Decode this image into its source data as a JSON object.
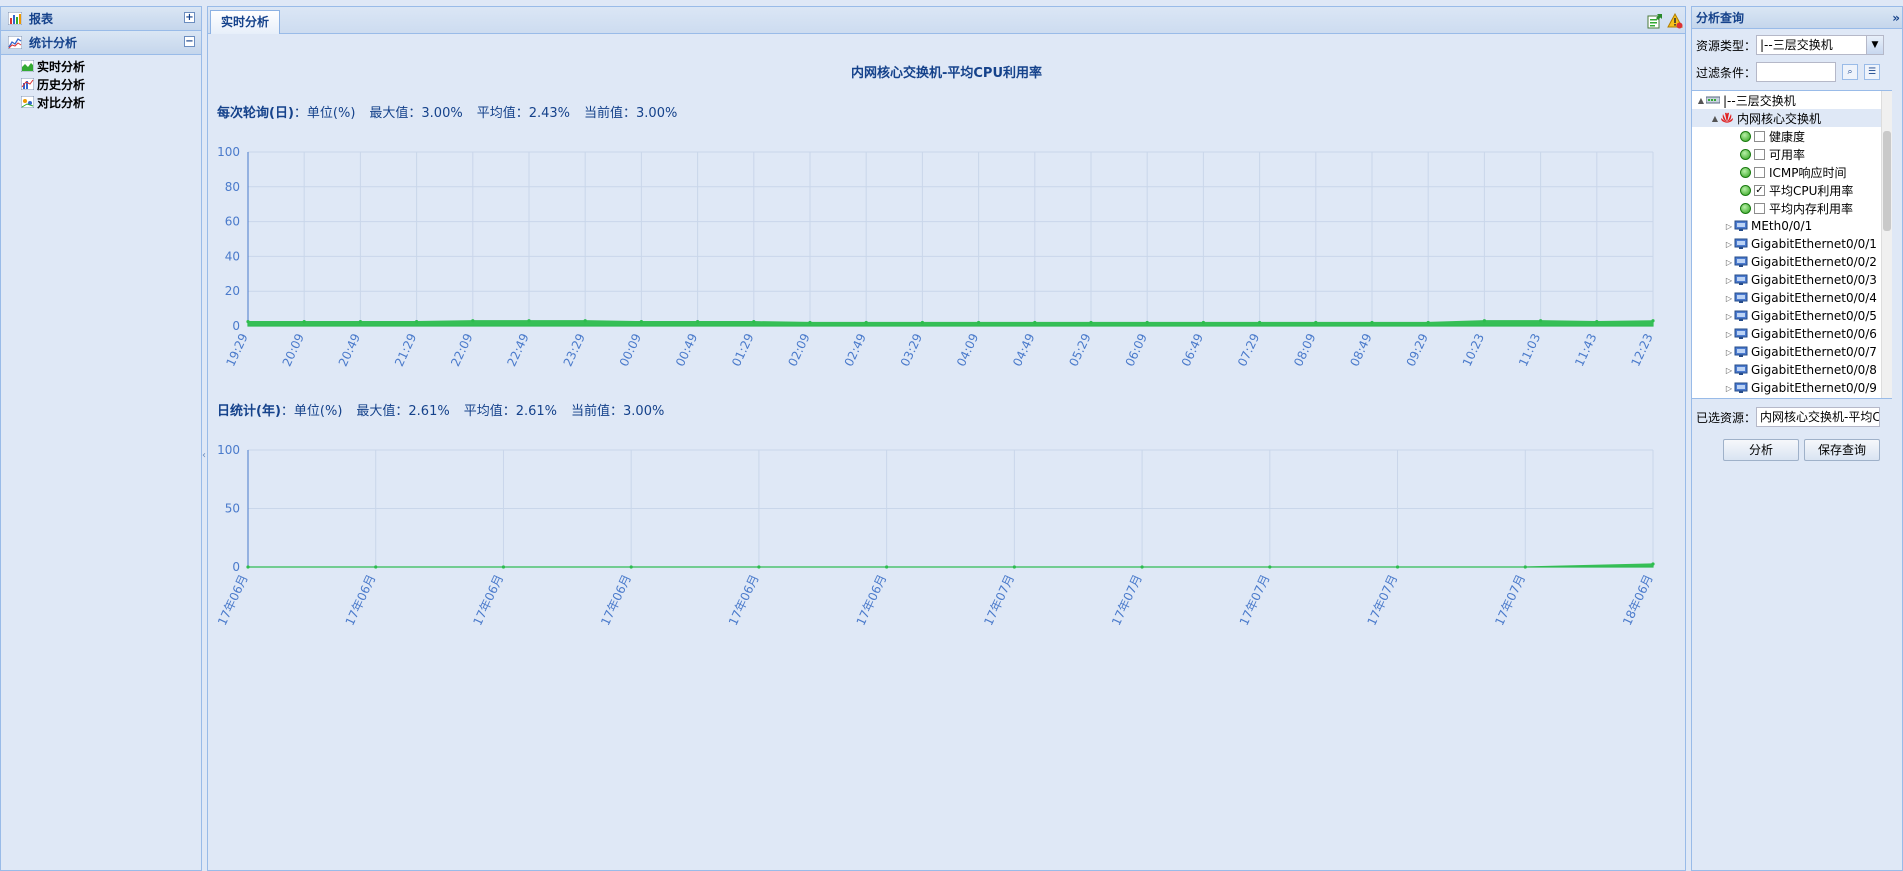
{
  "left_nav": {
    "sections": [
      {
        "label": "报表",
        "tool": "+"
      },
      {
        "label": "统计分析",
        "tool": "−"
      }
    ],
    "items": [
      "实时分析",
      "历史分析",
      "对比分析"
    ]
  },
  "center": {
    "tab_label": "实时分析",
    "title": "内网核心交换机-平均CPU利用率",
    "chart1_stats": {
      "heading": "每次轮询(日)",
      "unit": "：单位(%)",
      "max": "最大值：3.00%",
      "avg": "平均值：2.43%",
      "current": "当前值：3.00%"
    },
    "chart2_stats": {
      "heading": "日统计(年)",
      "unit": "：单位(%)",
      "max": "最大值：2.61%",
      "avg": "平均值：2.61%",
      "current": "当前值：3.00%"
    }
  },
  "chart_data": [
    {
      "type": "area",
      "x": [
        "19:29",
        "20:09",
        "20:49",
        "21:29",
        "22:09",
        "22:49",
        "23:29",
        "00:09",
        "00:49",
        "01:29",
        "02:09",
        "02:49",
        "03:29",
        "04:09",
        "04:49",
        "05:29",
        "06:09",
        "06:49",
        "07:29",
        "08:09",
        "08:49",
        "09:29",
        "10:23",
        "11:03",
        "11:43",
        "12:23"
      ],
      "yticks": [
        0,
        20,
        40,
        60,
        80,
        100
      ],
      "ylim": [
        0,
        100
      ],
      "values": [
        2.5,
        2.5,
        2.5,
        2.5,
        3,
        3,
        3,
        2.5,
        2.5,
        2.5,
        2,
        2,
        2,
        2,
        2,
        2,
        2,
        2,
        2,
        2,
        2,
        2,
        3,
        3,
        2.5,
        3
      ],
      "color": "#2ebd4e"
    },
    {
      "type": "area",
      "x": [
        "17年06月",
        "17年06月",
        "17年06月",
        "17年06月",
        "17年06月",
        "17年06月",
        "17年07月",
        "17年07月",
        "17年07月",
        "17年07月",
        "17年07月",
        "18年06月"
      ],
      "yticks": [
        0,
        50,
        100
      ],
      "ylim": [
        0,
        100
      ],
      "values": [
        0,
        0,
        0,
        0,
        0,
        0,
        0,
        0,
        0,
        0,
        0,
        2.61
      ],
      "color": "#2ebd4e"
    }
  ],
  "right": {
    "header": "分析查询",
    "collapse_glyph": "»",
    "resource_type_label": "资源类型：",
    "resource_type_value": "|--三层交换机",
    "filter_label": "过滤条件：",
    "filter_value": "",
    "tree": {
      "root": "|--三层交换机",
      "device": "内网核心交换机",
      "metrics": [
        {
          "label": "健康度",
          "checked": false
        },
        {
          "label": "可用率",
          "checked": false
        },
        {
          "label": "ICMP响应时间",
          "checked": false
        },
        {
          "label": "平均CPU利用率",
          "checked": true
        },
        {
          "label": "平均内存利用率",
          "checked": false
        }
      ],
      "interfaces": [
        "MEth0/0/1",
        "GigabitEthernet0/0/1",
        "GigabitEthernet0/0/2",
        "GigabitEthernet0/0/3",
        "GigabitEthernet0/0/4",
        "GigabitEthernet0/0/5",
        "GigabitEthernet0/0/6",
        "GigabitEthernet0/0/7",
        "GigabitEthernet0/0/8",
        "GigabitEthernet0/0/9"
      ]
    },
    "selected_label": "已选资源：",
    "selected_value": "内网核心交换机-平均CPU利",
    "analyze_button": "分析",
    "save_button": "保存查询"
  }
}
